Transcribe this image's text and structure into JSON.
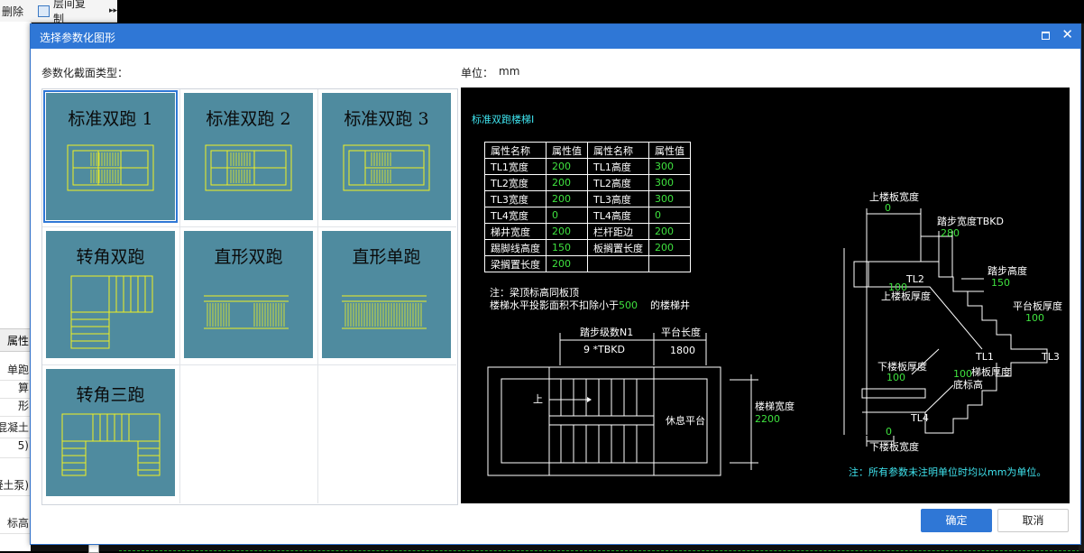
{
  "background": {
    "toolbar": {
      "delete_label": "删除",
      "floor_copy_label": "层间复制",
      "more_glyph": "▸▸"
    },
    "left_panel": {
      "header": "属性",
      "rows": [
        "单跑",
        "算",
        "形",
        "混凝土",
        "5)",
        "凝土泵)",
        "标高"
      ]
    }
  },
  "dialog": {
    "title": "选择参数化图形",
    "section_type_label": "参数化截面类型：",
    "unit_label": "单位：",
    "unit_value": "mm",
    "buttons": {
      "ok": "确定",
      "cancel": "取消"
    },
    "shapes": [
      {
        "name": "标准双跑 1",
        "selected": true
      },
      {
        "name": "标准双跑 2",
        "selected": false
      },
      {
        "name": "标准双跑 3",
        "selected": false
      },
      {
        "name": "转角双跑",
        "selected": false
      },
      {
        "name": "直形双跑",
        "selected": false
      },
      {
        "name": "直形单跑",
        "selected": false
      },
      {
        "name": "转角三跑",
        "selected": false
      }
    ]
  },
  "preview": {
    "heading": "标准双跑楼梯Ⅰ",
    "table_headers": [
      "属性名称",
      "属性值",
      "属性名称",
      "属性值"
    ],
    "table_rows": [
      [
        "TL1宽度",
        "200",
        "TL1高度",
        "300"
      ],
      [
        "TL2宽度",
        "200",
        "TL2高度",
        "300"
      ],
      [
        "TL3宽度",
        "200",
        "TL3高度",
        "300"
      ],
      [
        "TL4宽度",
        "0",
        "TL4高度",
        "0"
      ],
      [
        "梯井宽度",
        "200",
        "栏杆距边",
        "200"
      ],
      [
        "踢脚线高度",
        "150",
        "板搁置长度",
        "200"
      ],
      [
        "梁搁置长度",
        "200",
        "",
        ""
      ]
    ],
    "note_line1": "注：梁顶标高同板顶",
    "note_line2a": "楼梯水平投影面积不扣除小于",
    "note_line2_value": "500",
    "note_line2b": "的楼梯井",
    "plan": {
      "steps_label": "踏步级数N1",
      "steps_formula": "9 *TBKD",
      "platform_len_label": "平台长度",
      "platform_len_value": "1800",
      "up_label": "上",
      "rest_label": "休息平台",
      "width_label": "楼梯宽度",
      "width_value": "2200"
    },
    "section": {
      "top_slab_width_label": "上楼板宽度",
      "top_slab_width_value": "0",
      "tread_width_label": "踏步宽度TBKD",
      "tread_width_value": "280",
      "tread_height_label": "踏步高度",
      "tread_height_value": "150",
      "tl2_label": "TL2",
      "top_slab_thk_value": "100",
      "top_slab_thk_label": "上楼板厚度",
      "platform_thk_label": "平台板厚度",
      "platform_thk_value": "100",
      "tl1_label": "TL1",
      "tl3_label": "TL3",
      "bottom_slab_thk_label": "下楼板厚度",
      "bottom_slab_thk_value": "100",
      "stair_slab_thk_value": "100",
      "stair_slab_thk_label": "梯板厚度",
      "bottom_elev_label": "底标高",
      "tl4_label": "TL4",
      "bottom_slab_width_value": "0",
      "bottom_slab_width_label": "下楼板宽度"
    },
    "footer_note": "注：所有参数未注明单位时均以mm为单位。"
  },
  "colors": {
    "accent": "#2f77d6",
    "tile": "#4f8b9f",
    "cad_yellow": "#f0f020",
    "cad_cyan": "#3fe3ee",
    "cad_green": "#3fe23f"
  }
}
